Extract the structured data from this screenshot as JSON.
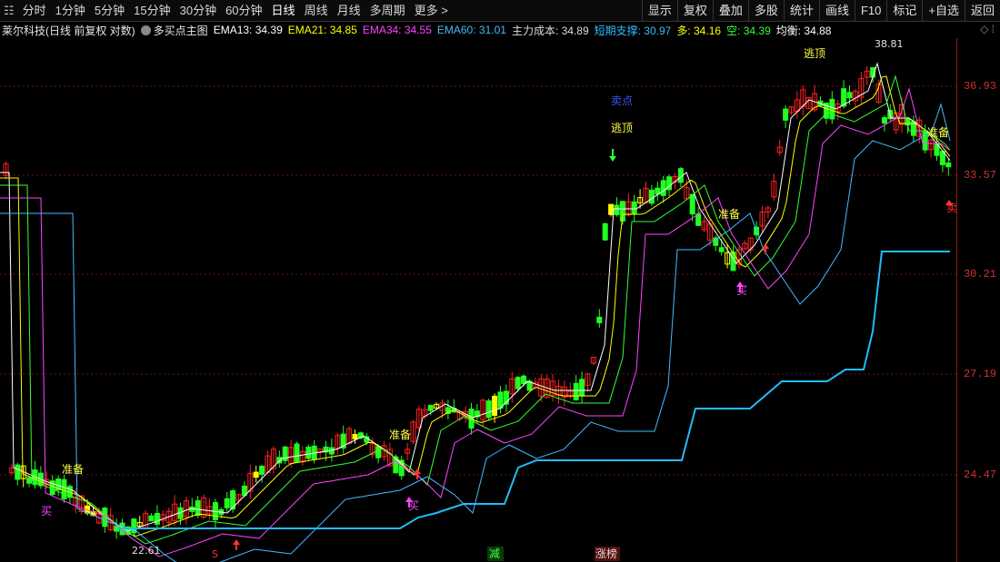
{
  "toolbar": {
    "period_tabs": [
      "分时",
      "1分钟",
      "5分钟",
      "15分钟",
      "30分钟",
      "60分钟",
      "日线",
      "周线",
      "月线",
      "多周期",
      "更多 >"
    ],
    "active_tab": "日线",
    "right_buttons": [
      "显示",
      "复权",
      "叠加",
      "多股",
      "统计",
      "画线",
      "F10",
      "标记",
      "+自选",
      "返回"
    ]
  },
  "info": {
    "stock_title": "莱尔科技(日线 前复权 对数)",
    "indicator_name": "多买点主图",
    "ema13_label": "EMA13: 34.39",
    "ema21_label": "EMA21: 34.85",
    "ema34_label": "EMA34: 34.55",
    "ema60_label": "EMA60: 31.01",
    "main_cost_label": "主力成本: 34.89",
    "short_support_label": "短期支撑: 30.97",
    "bull_label": "多: 34.16",
    "bear_label": "空: 34.39",
    "balance_label": "均衡: 34.88",
    "colors": {
      "ema13": "#ffffff",
      "ema21": "#ffff00",
      "ema34": "#ff44ff",
      "ema60": "#44bbff",
      "main_cost": "#dddddd",
      "support": "#33bbff",
      "bull": "#ffff00",
      "bear": "#33ff33",
      "balance": "#ffffff"
    }
  },
  "price_axis": [
    "36.93",
    "33.57",
    "30.21",
    "27.19",
    "24.47"
  ],
  "annotations": {
    "high_label": "38.81",
    "low_label": "22.61",
    "sell_point": "卖点",
    "escape_top_1": "逃顶",
    "escape_top_2": "逃顶",
    "prepare_1": "准备",
    "prepare_2": "准备",
    "prepare_3": "准备",
    "prepare_4": "准备",
    "buy_1": "买",
    "buy_2": "买",
    "buy_3": "买",
    "sell_edge": "卖",
    "reduce": "减",
    "limit_up": "涨榜",
    "s_mark": "S"
  }
}
